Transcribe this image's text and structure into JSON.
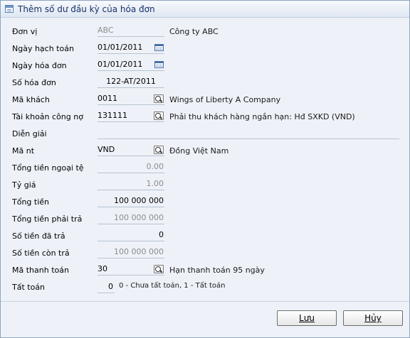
{
  "window": {
    "title": "Thêm số dư đầu kỳ của hóa đơn"
  },
  "form": {
    "don_vi": {
      "label": "Đơn vị",
      "value": "ABC",
      "desc": "Công ty ABC"
    },
    "ngay_hach_toan": {
      "label": "Ngày hạch toán",
      "value": "01/01/2011"
    },
    "ngay_hoa_don": {
      "label": "Ngày hóa đơn",
      "value": "01/01/2011"
    },
    "so_hoa_don": {
      "label": "Số hóa đơn",
      "value": "122-AT/2011"
    },
    "ma_khach": {
      "label": "Mã khách",
      "value": "0011",
      "desc": "Wings of Liberty A Company"
    },
    "tai_khoan_cong_no": {
      "label": "Tài khoản công nợ",
      "value": "131111",
      "desc": "Phải thu khách hàng ngắn hạn: Hđ SXKD (VND)"
    },
    "dien_giai": {
      "label": "Diễn giải",
      "value": ""
    },
    "ma_nt": {
      "label": "Mã nt",
      "value": "VND",
      "desc": "Đồng Việt Nam"
    },
    "tong_tien_ngoai_te": {
      "label": "Tổng tiền ngoại tệ",
      "value": "0.00"
    },
    "ty_gia": {
      "label": "Tỷ giá",
      "value": "1.00"
    },
    "tong_tien": {
      "label": "Tổng tiền",
      "value": "100 000 000"
    },
    "tong_tien_phai_tra": {
      "label": "Tổng tiền phải trả",
      "value": "100 000 000"
    },
    "so_tien_da_tra": {
      "label": "Số tiền đã trả",
      "value": "0"
    },
    "so_tien_con_tra": {
      "label": "Số tiền còn trả",
      "value": "100 000 000"
    },
    "ma_thanh_toan": {
      "label": "Mã thanh toán",
      "value": "30",
      "desc": "Hạn thanh toán 95 ngày"
    },
    "tat_toan": {
      "label": "Tất toán",
      "value": "0",
      "hint": "0 - Chưa tất toán, 1 - Tất toán"
    }
  },
  "buttons": {
    "save": "Lưu",
    "cancel": "Hủy"
  },
  "icons": {
    "title": "form-icon",
    "calendar": "calendar-icon",
    "lookup": "lookup-icon"
  },
  "colors": {
    "title_text": "#15326a",
    "background": "#eef2f8",
    "disabled_text": "#8c8c8c"
  }
}
